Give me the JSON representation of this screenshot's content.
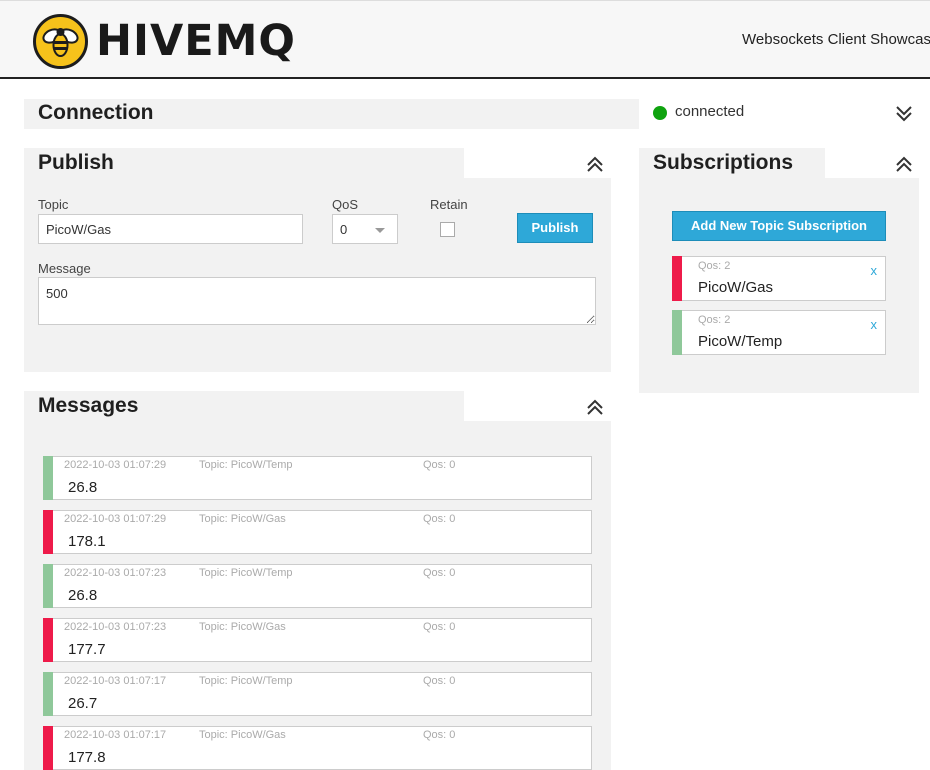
{
  "header": {
    "logo_text": "HIVEMQ",
    "title": "Websockets Client Showcase"
  },
  "connection": {
    "title": "Connection",
    "status": "connected",
    "status_color": "#0fa30f"
  },
  "publish": {
    "title": "Publish",
    "topic_label": "Topic",
    "topic_value": "PicoW/Gas",
    "qos_label": "QoS",
    "qos_value": "0",
    "retain_label": "Retain",
    "retain_checked": false,
    "button_label": "Publish",
    "message_label": "Message",
    "message_value": "500"
  },
  "subscriptions": {
    "title": "Subscriptions",
    "add_button_label": "Add New Topic Subscription",
    "items": [
      {
        "qos": "Qos: 2",
        "topic": "PicoW/Gas",
        "color": "#ee1b4a",
        "remove": "x"
      },
      {
        "qos": "Qos: 2",
        "topic": "PicoW/Temp",
        "color": "#8fc89a",
        "remove": "x"
      }
    ]
  },
  "messages": {
    "title": "Messages",
    "items": [
      {
        "timestamp": "2022-10-03 01:07:29",
        "topic": "Topic: PicoW/Temp",
        "qos": "Qos: 0",
        "value": "26.8",
        "color": "#8fc89a"
      },
      {
        "timestamp": "2022-10-03 01:07:29",
        "topic": "Topic: PicoW/Gas",
        "qos": "Qos: 0",
        "value": "178.1",
        "color": "#ee1b4a"
      },
      {
        "timestamp": "2022-10-03 01:07:23",
        "topic": "Topic: PicoW/Temp",
        "qos": "Qos: 0",
        "value": "26.8",
        "color": "#8fc89a"
      },
      {
        "timestamp": "2022-10-03 01:07:23",
        "topic": "Topic: PicoW/Gas",
        "qos": "Qos: 0",
        "value": "177.7",
        "color": "#ee1b4a"
      },
      {
        "timestamp": "2022-10-03 01:07:17",
        "topic": "Topic: PicoW/Temp",
        "qos": "Qos: 0",
        "value": "26.7",
        "color": "#8fc89a"
      },
      {
        "timestamp": "2022-10-03 01:07:17",
        "topic": "Topic: PicoW/Gas",
        "qos": "Qos: 0",
        "value": "177.8",
        "color": "#ee1b4a"
      }
    ]
  }
}
